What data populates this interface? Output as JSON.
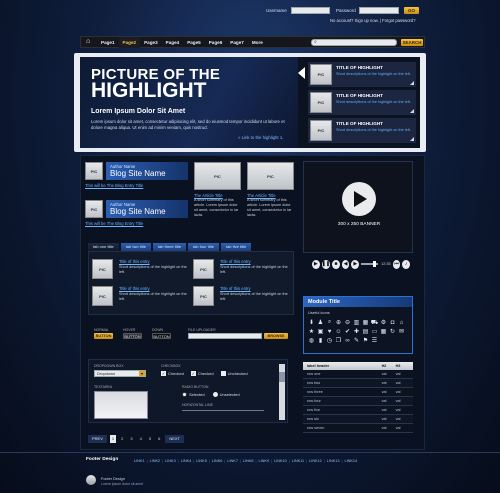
{
  "login": {
    "username_label": "Username",
    "password_label": "Password",
    "go_label": "GO",
    "signup_text": "No account? Sign up now. | Forgot password?"
  },
  "nav": {
    "items": [
      "Page1",
      "Page2",
      "Page3",
      "Page4",
      "Page5",
      "Page6",
      "Page7",
      "More"
    ],
    "active_index": 1,
    "search_button": "SEARCH"
  },
  "hero": {
    "title_line1": "PICTURE OF THE",
    "title_line2": "HIGHLIGHT",
    "subtitle": "Lorem Ipsum Dolor Sit Amet",
    "body": "Lorem ipsum dolor sit amet, consectetur adipisicing elit, sed do eiusmod tempor incididunt ut labore et dolore magna aliqua. Ut enim ad minim veniam, quis nostrud.",
    "link": "Link to the highlight 1.",
    "pic_label": "PIC",
    "items": [
      {
        "title": "TITLE OF HIGHLIGHT",
        "desc": "Short descriptions of the highlight on the left."
      },
      {
        "title": "TITLE OF HIGHLIGHT",
        "desc": "Short descriptions of the highlight on the left."
      },
      {
        "title": "TITLE OF HIGHLIGHT",
        "desc": "Short descriptions of the highlight on the left."
      }
    ]
  },
  "blog": {
    "author_label": "Author Name",
    "site_name": "Blog Site Name",
    "entry_link": "This will be The Blog Entry Title",
    "pic_label": "PIC"
  },
  "articles": {
    "title": "The Article Title",
    "text": "A short summary of this article. Lorem ipsum dolor sit amet, consectetur in lar lacta.",
    "pic_label": "PIC"
  },
  "banner": {
    "label": "300 x 250 BANNER",
    "time": "12:35"
  },
  "tabs": {
    "items": [
      "tab one title",
      "tab two title",
      "tab three title",
      "tab four title",
      "tab five title"
    ],
    "entry_title": "Title of this entry",
    "entry_desc": "Short descriptions of the highlight on the left.",
    "pic_label": "PIC"
  },
  "module": {
    "title": "Module Title",
    "useful_icons": "Useful icons"
  },
  "buttons": {
    "normal_label": "NORMAL",
    "hover_label": "HOVER",
    "down_label": "DOWN",
    "button_text": "BUTTON",
    "file_upload_label": "FILE UPLOADER",
    "browse_text": "BROWSE"
  },
  "form": {
    "dropdown_label": "DROPDOWN BOX",
    "dropdown_value": "Dropdown",
    "checkbox_label": "CHECKBOX",
    "checked": "Checked",
    "unchecked": "Unchecked",
    "textarea_label": "TEXTAREA",
    "radio_label": "RADIO BUTTON",
    "selected": "Selected",
    "unselected": "Unselected",
    "hline_label": "HORIZONTAL LINE"
  },
  "table": {
    "header": [
      "label header",
      "H2",
      "H3"
    ],
    "rows": [
      [
        "row one",
        "val",
        "val"
      ],
      [
        "row two",
        "val",
        "val"
      ],
      [
        "row three",
        "val",
        "val"
      ],
      [
        "row four",
        "val",
        "val"
      ],
      [
        "row five",
        "val",
        "val"
      ],
      [
        "row six",
        "val",
        "val"
      ],
      [
        "row seven",
        "val",
        "val"
      ]
    ]
  },
  "pagination": {
    "prev": "PREV",
    "next": "NEXT",
    "pages": [
      "1",
      "2",
      "3",
      "4",
      "5",
      "6"
    ]
  },
  "footer": {
    "title": "Footer Design",
    "links": [
      "LINK1",
      "LINK2",
      "LINK3",
      "LINK4",
      "LINK5",
      "LINK6",
      "LINK7",
      "LINK8",
      "LINK9",
      "LINK10",
      "LINK11",
      "LINK12",
      "LINK13",
      "LINK14"
    ],
    "brand": "Footer Design",
    "tagline": "Lorem ipsum dolor sit amet"
  },
  "colors": {
    "accent": "#f2c24a",
    "link": "#6cb4ff",
    "nav_bg": "#15171c",
    "panel": "#0b1220"
  }
}
